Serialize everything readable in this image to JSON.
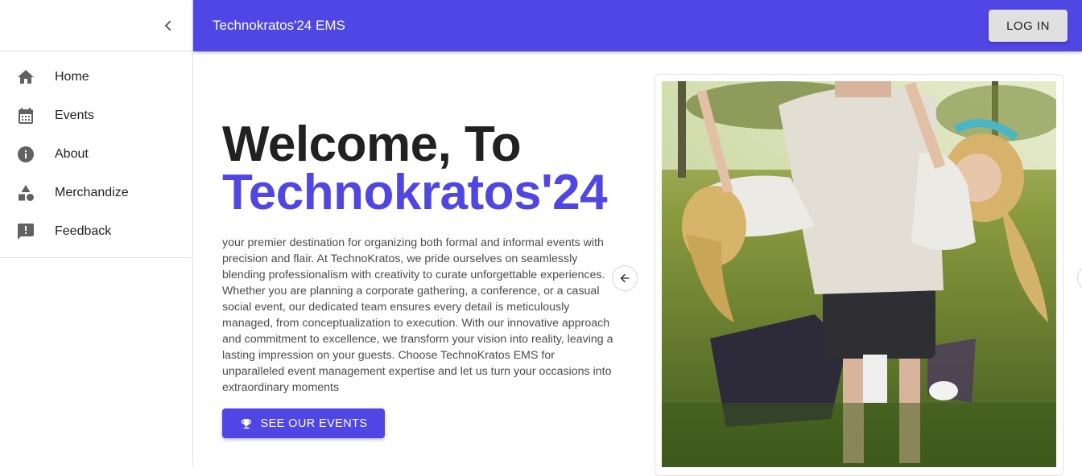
{
  "sidebar": {
    "items": [
      {
        "label": "Home",
        "icon": "home-icon"
      },
      {
        "label": "Events",
        "icon": "calendar-icon"
      },
      {
        "label": "About",
        "icon": "info-icon"
      },
      {
        "label": "Merchandize",
        "icon": "category-icon"
      },
      {
        "label": "Feedback",
        "icon": "feedback-icon"
      }
    ]
  },
  "appbar": {
    "title": "Technokratos'24 EMS",
    "login_label": "LOG IN"
  },
  "hero": {
    "line1": "Welcome, To",
    "line2": "Technokratos'24",
    "description": "your premier destination for organizing both formal and informal events with precision and flair. At TechnoKratos, we pride ourselves on seamlessly blending professionalism with creativity to curate unforgettable experiences. Whether you are planning a corporate gathering, a conference, or a casual social event, our dedicated team ensures every detail is meticulously managed, from conceptualization to execution. With our innovative approach and commitment to excellence, we transform your vision into reality, leaving a lasting impression on your guests. Choose TechnoKratos EMS for unparalleled event management expertise and let us turn your occasions into extraordinary moments",
    "cta_label": "SEE OUR EVENTS",
    "cta_icon": "trophy-icon"
  },
  "colors": {
    "primary": "#4f46e5",
    "heading": "#212121",
    "body_text": "#4b4b4b"
  }
}
